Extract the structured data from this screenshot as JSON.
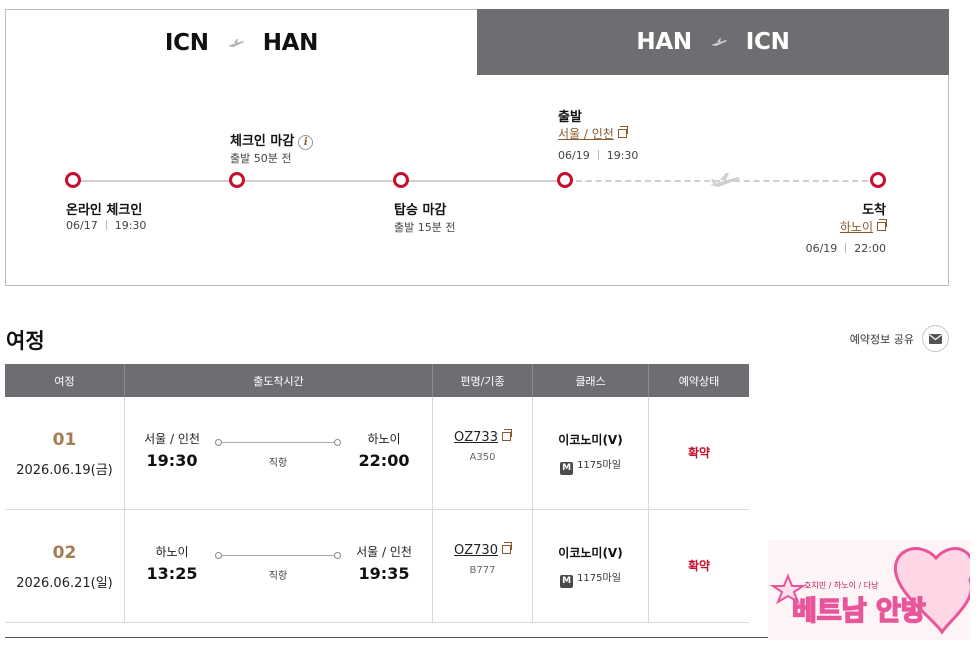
{
  "tabs": {
    "outbound": {
      "from": "ICN",
      "to": "HAN"
    },
    "inbound": {
      "from": "HAN",
      "to": "ICN"
    }
  },
  "timeline": {
    "online_checkin": {
      "title": "온라인 체크인",
      "date": "06/17",
      "time": "19:30"
    },
    "checkin_deadline": {
      "title": "체크인 마감",
      "note": "출발 50분 전"
    },
    "boarding_deadline": {
      "title": "탑승 마감",
      "note": "출발 15분 전"
    },
    "departure": {
      "title": "출발",
      "city": "서울 / 인천",
      "date": "06/19",
      "time": "19:30"
    },
    "arrival": {
      "title": "도착",
      "city": "하노이",
      "date": "06/19",
      "time": "22:00"
    }
  },
  "itinerary": {
    "title": "여정",
    "share_label": "예약정보 공유",
    "headers": [
      "여정",
      "출도착시간",
      "편명/기종",
      "클래스",
      "예약상태"
    ],
    "segments": [
      {
        "no": "01",
        "date": "2026.06.19(금)",
        "dep_city": "서울 / 인천",
        "dep_time": "19:30",
        "arr_city": "하노이",
        "arr_time": "22:00",
        "type": "직항",
        "flight": "OZ733",
        "aircraft": "A350",
        "class": "이코노미(V)",
        "miles": "1175마일",
        "status": "확약"
      },
      {
        "no": "02",
        "date": "2026.06.21(일)",
        "dep_city": "하노이",
        "dep_time": "13:25",
        "arr_city": "서울 / 인천",
        "arr_time": "19:35",
        "type": "직항",
        "flight": "OZ730",
        "aircraft": "B777",
        "class": "이코노미(V)",
        "miles": "1175마일",
        "status": "확약"
      }
    ]
  },
  "watermark": {
    "small": "호치민 / 하노이 / 다낭",
    "big": "베트남 안방"
  },
  "colors": {
    "accent": "#c8102e",
    "tab_inactive": "#6d6e71",
    "brown": "#a67c52"
  }
}
